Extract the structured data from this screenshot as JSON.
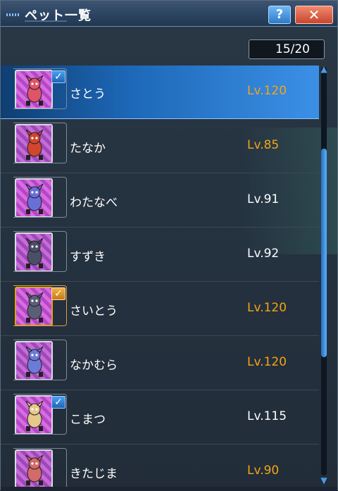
{
  "window": {
    "title": "ペット一覧",
    "help_label": "?",
    "close_label": "✕"
  },
  "counter": "15/20",
  "colors": {
    "level_highlight": "#f3a516",
    "selected_row": "#2a78d0"
  },
  "pets": [
    {
      "name": "さとう",
      "level": "Lv.120",
      "selected": true,
      "checked": true,
      "check_style": "blue",
      "highlight": true
    },
    {
      "name": "たなか",
      "level": "Lv.85",
      "selected": false,
      "checked": false,
      "highlight": true
    },
    {
      "name": "わたなべ",
      "level": "Lv.91",
      "selected": false,
      "checked": false,
      "highlight": false
    },
    {
      "name": "すずき",
      "level": "Lv.92",
      "selected": false,
      "checked": false,
      "highlight": false
    },
    {
      "name": "さいとう",
      "level": "Lv.120",
      "selected": false,
      "checked": true,
      "check_style": "gold",
      "highlight": true
    },
    {
      "name": "なかむら",
      "level": "Lv.120",
      "selected": false,
      "checked": false,
      "highlight": true
    },
    {
      "name": "こまつ",
      "level": "Lv.115",
      "selected": false,
      "checked": true,
      "check_style": "blue",
      "highlight": false
    },
    {
      "name": "きたじま",
      "level": "Lv.90",
      "selected": false,
      "checked": false,
      "highlight": true
    }
  ]
}
